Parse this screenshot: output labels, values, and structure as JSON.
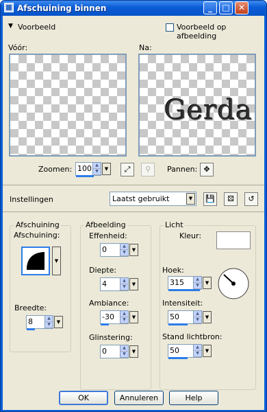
{
  "window": {
    "title": "Afschuining binnen"
  },
  "preview": {
    "toggle_label": "Voorbeeld",
    "on_image_label": "Voorbeeld op afbeelding",
    "before_label": "Vóór:",
    "after_label": "Na:",
    "after_text": "Gerda",
    "zoom_label": "Zoomen:",
    "zoom_value": "100",
    "pan_label": "Pannen:"
  },
  "settings": {
    "label": "Instellingen",
    "preset_value": "Laatst gebruikt"
  },
  "bevel": {
    "group_title": "Afschuining",
    "shape_label": "Afschuining:",
    "width_label": "Breedte:",
    "width_value": "8"
  },
  "image": {
    "group_title": "Afbeelding",
    "smoothness_label": "Effenheid:",
    "smoothness_value": "0",
    "depth_label": "Diepte:",
    "depth_value": "4",
    "ambience_label": "Ambiance:",
    "ambience_value": "-30",
    "shininess_label": "Glinstering:",
    "shininess_value": "0"
  },
  "light": {
    "group_title": "Licht",
    "color_label": "Kleur:",
    "color": "#ffffff",
    "angle_label": "Hoek:",
    "angle_value": "315",
    "intensity_label": "Intensiteit:",
    "intensity_value": "50",
    "elevation_label": "Stand lichtbron:",
    "elevation_value": "50"
  },
  "buttons": {
    "ok": "OK",
    "cancel": "Annuleren",
    "help": "Help"
  }
}
